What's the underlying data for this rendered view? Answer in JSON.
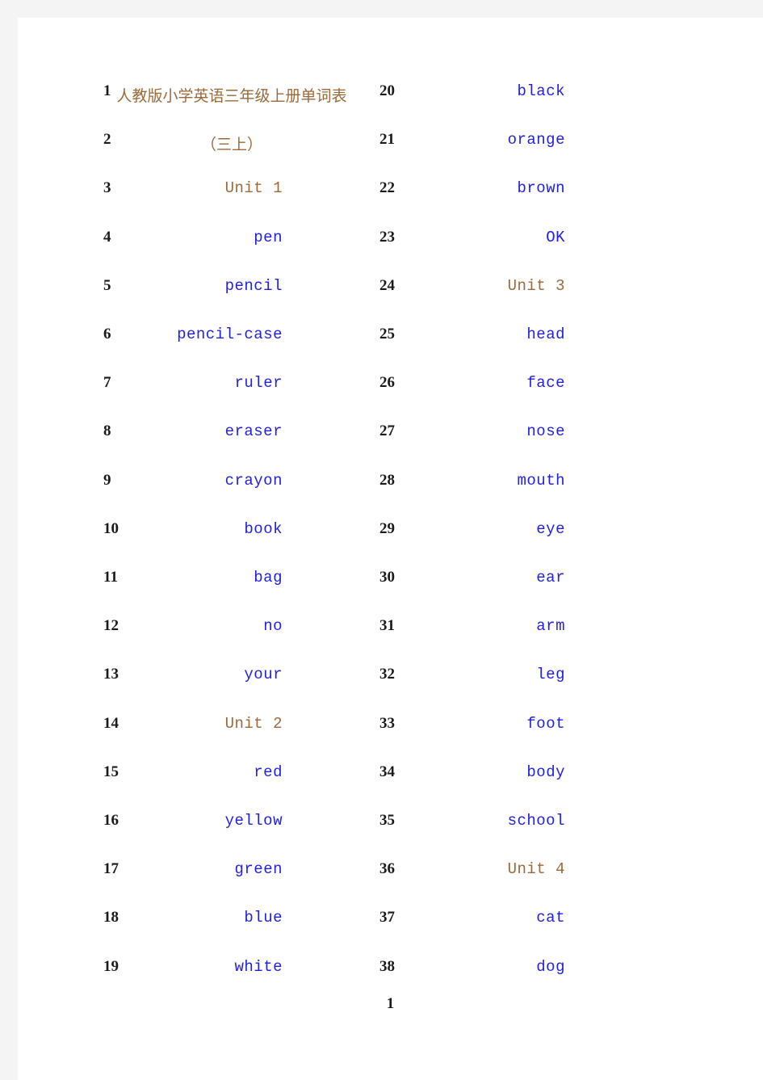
{
  "document": {
    "title_text": "人教版小学英语三年级上册单词表（三上）",
    "page_number": "1",
    "colors": {
      "word_blue": "#2222dd",
      "unit_brown": "#9a6a3a",
      "number_black": "#1a1a1a",
      "page_background": "#ffffff",
      "canvas_background": "#f4f4f4"
    }
  },
  "columns": {
    "left": {
      "rows": [
        {
          "num": "1",
          "word": "",
          "style": "blue"
        },
        {
          "num": "2",
          "word": "",
          "style": "blue"
        },
        {
          "num": "3",
          "word": "Unit 1",
          "style": "unit"
        },
        {
          "num": "4",
          "word": "pen",
          "style": "blue"
        },
        {
          "num": "5",
          "word": "pencil",
          "style": "blue"
        },
        {
          "num": "6",
          "word": "pencil-case",
          "style": "blue"
        },
        {
          "num": "7",
          "word": "ruler",
          "style": "blue"
        },
        {
          "num": "8",
          "word": "eraser",
          "style": "blue"
        },
        {
          "num": "9",
          "word": "crayon",
          "style": "blue"
        },
        {
          "num": "10",
          "word": "book",
          "style": "blue"
        },
        {
          "num": "11",
          "word": "bag",
          "style": "blue"
        },
        {
          "num": "12",
          "word": "no",
          "style": "blue"
        },
        {
          "num": "13",
          "word": "your",
          "style": "blue"
        },
        {
          "num": "14",
          "word": "Unit 2",
          "style": "unit"
        },
        {
          "num": "15",
          "word": "red",
          "style": "blue"
        },
        {
          "num": "16",
          "word": "yellow",
          "style": "blue"
        },
        {
          "num": "17",
          "word": "green",
          "style": "blue"
        },
        {
          "num": "18",
          "word": "blue",
          "style": "blue"
        },
        {
          "num": "19",
          "word": "white",
          "style": "blue"
        }
      ]
    },
    "right": {
      "rows": [
        {
          "num": "20",
          "word": "black",
          "style": "blue"
        },
        {
          "num": "21",
          "word": "orange",
          "style": "blue"
        },
        {
          "num": "22",
          "word": "brown",
          "style": "blue"
        },
        {
          "num": "23",
          "word": "OK",
          "style": "blue"
        },
        {
          "num": "24",
          "word": "Unit 3",
          "style": "unit"
        },
        {
          "num": "25",
          "word": "head",
          "style": "blue"
        },
        {
          "num": "26",
          "word": "face",
          "style": "blue"
        },
        {
          "num": "27",
          "word": "nose",
          "style": "blue"
        },
        {
          "num": "28",
          "word": "mouth",
          "style": "blue"
        },
        {
          "num": "29",
          "word": "eye",
          "style": "blue"
        },
        {
          "num": "30",
          "word": "ear",
          "style": "blue"
        },
        {
          "num": "31",
          "word": "arm",
          "style": "blue"
        },
        {
          "num": "32",
          "word": "leg",
          "style": "blue"
        },
        {
          "num": "33",
          "word": "foot",
          "style": "blue"
        },
        {
          "num": "34",
          "word": "body",
          "style": "blue"
        },
        {
          "num": "35",
          "word": "school",
          "style": "blue"
        },
        {
          "num": "36",
          "word": "Unit 4",
          "style": "unit"
        },
        {
          "num": "37",
          "word": "cat",
          "style": "blue"
        },
        {
          "num": "38",
          "word": "dog",
          "style": "blue"
        }
      ]
    }
  }
}
